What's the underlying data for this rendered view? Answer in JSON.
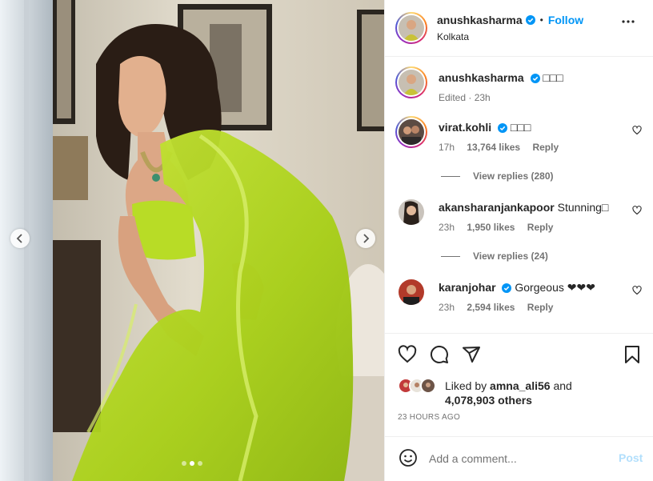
{
  "post": {
    "username": "anushkasharma",
    "follow_label": "Follow",
    "separator": "•",
    "location": "Kolkata",
    "more_icon": "more-horizontal-icon",
    "caption_emoji": "□□□",
    "caption_meta": "Edited · 23h"
  },
  "comments": [
    {
      "username": "virat.kohli",
      "verified": true,
      "text": "□□□",
      "time": "17h",
      "likes": "13,764 likes",
      "reply_label": "Reply",
      "view_replies": "View replies (280)"
    },
    {
      "username": "akansharanjankapoor",
      "verified": false,
      "text": "Stunning□",
      "time": "23h",
      "likes": "1,950 likes",
      "reply_label": "Reply",
      "view_replies": "View replies (24)"
    },
    {
      "username": "karanjohar",
      "verified": true,
      "text": "Gorgeous ❤❤❤",
      "time": "23h",
      "likes": "2,594 likes",
      "reply_label": "Reply"
    }
  ],
  "actions": {
    "like_icon": "heart-icon",
    "comment_icon": "comment-icon",
    "share_icon": "share-icon",
    "save_icon": "bookmark-icon"
  },
  "likes": {
    "liked_by_prefix": "Liked by",
    "liked_by_user": "amna_ali56",
    "and_label": "and",
    "others": "4,078,903 others",
    "posted_ago": "23 HOURS AGO"
  },
  "add_comment": {
    "placeholder": "Add a comment...",
    "post_label": "Post"
  },
  "carousel": {
    "slide_count": 3,
    "active_slide": 2
  },
  "colors": {
    "accent": "#0095f6",
    "verified": "#0095f6",
    "post_disabled": "#b2dffc",
    "saree": "#b5d91f"
  }
}
